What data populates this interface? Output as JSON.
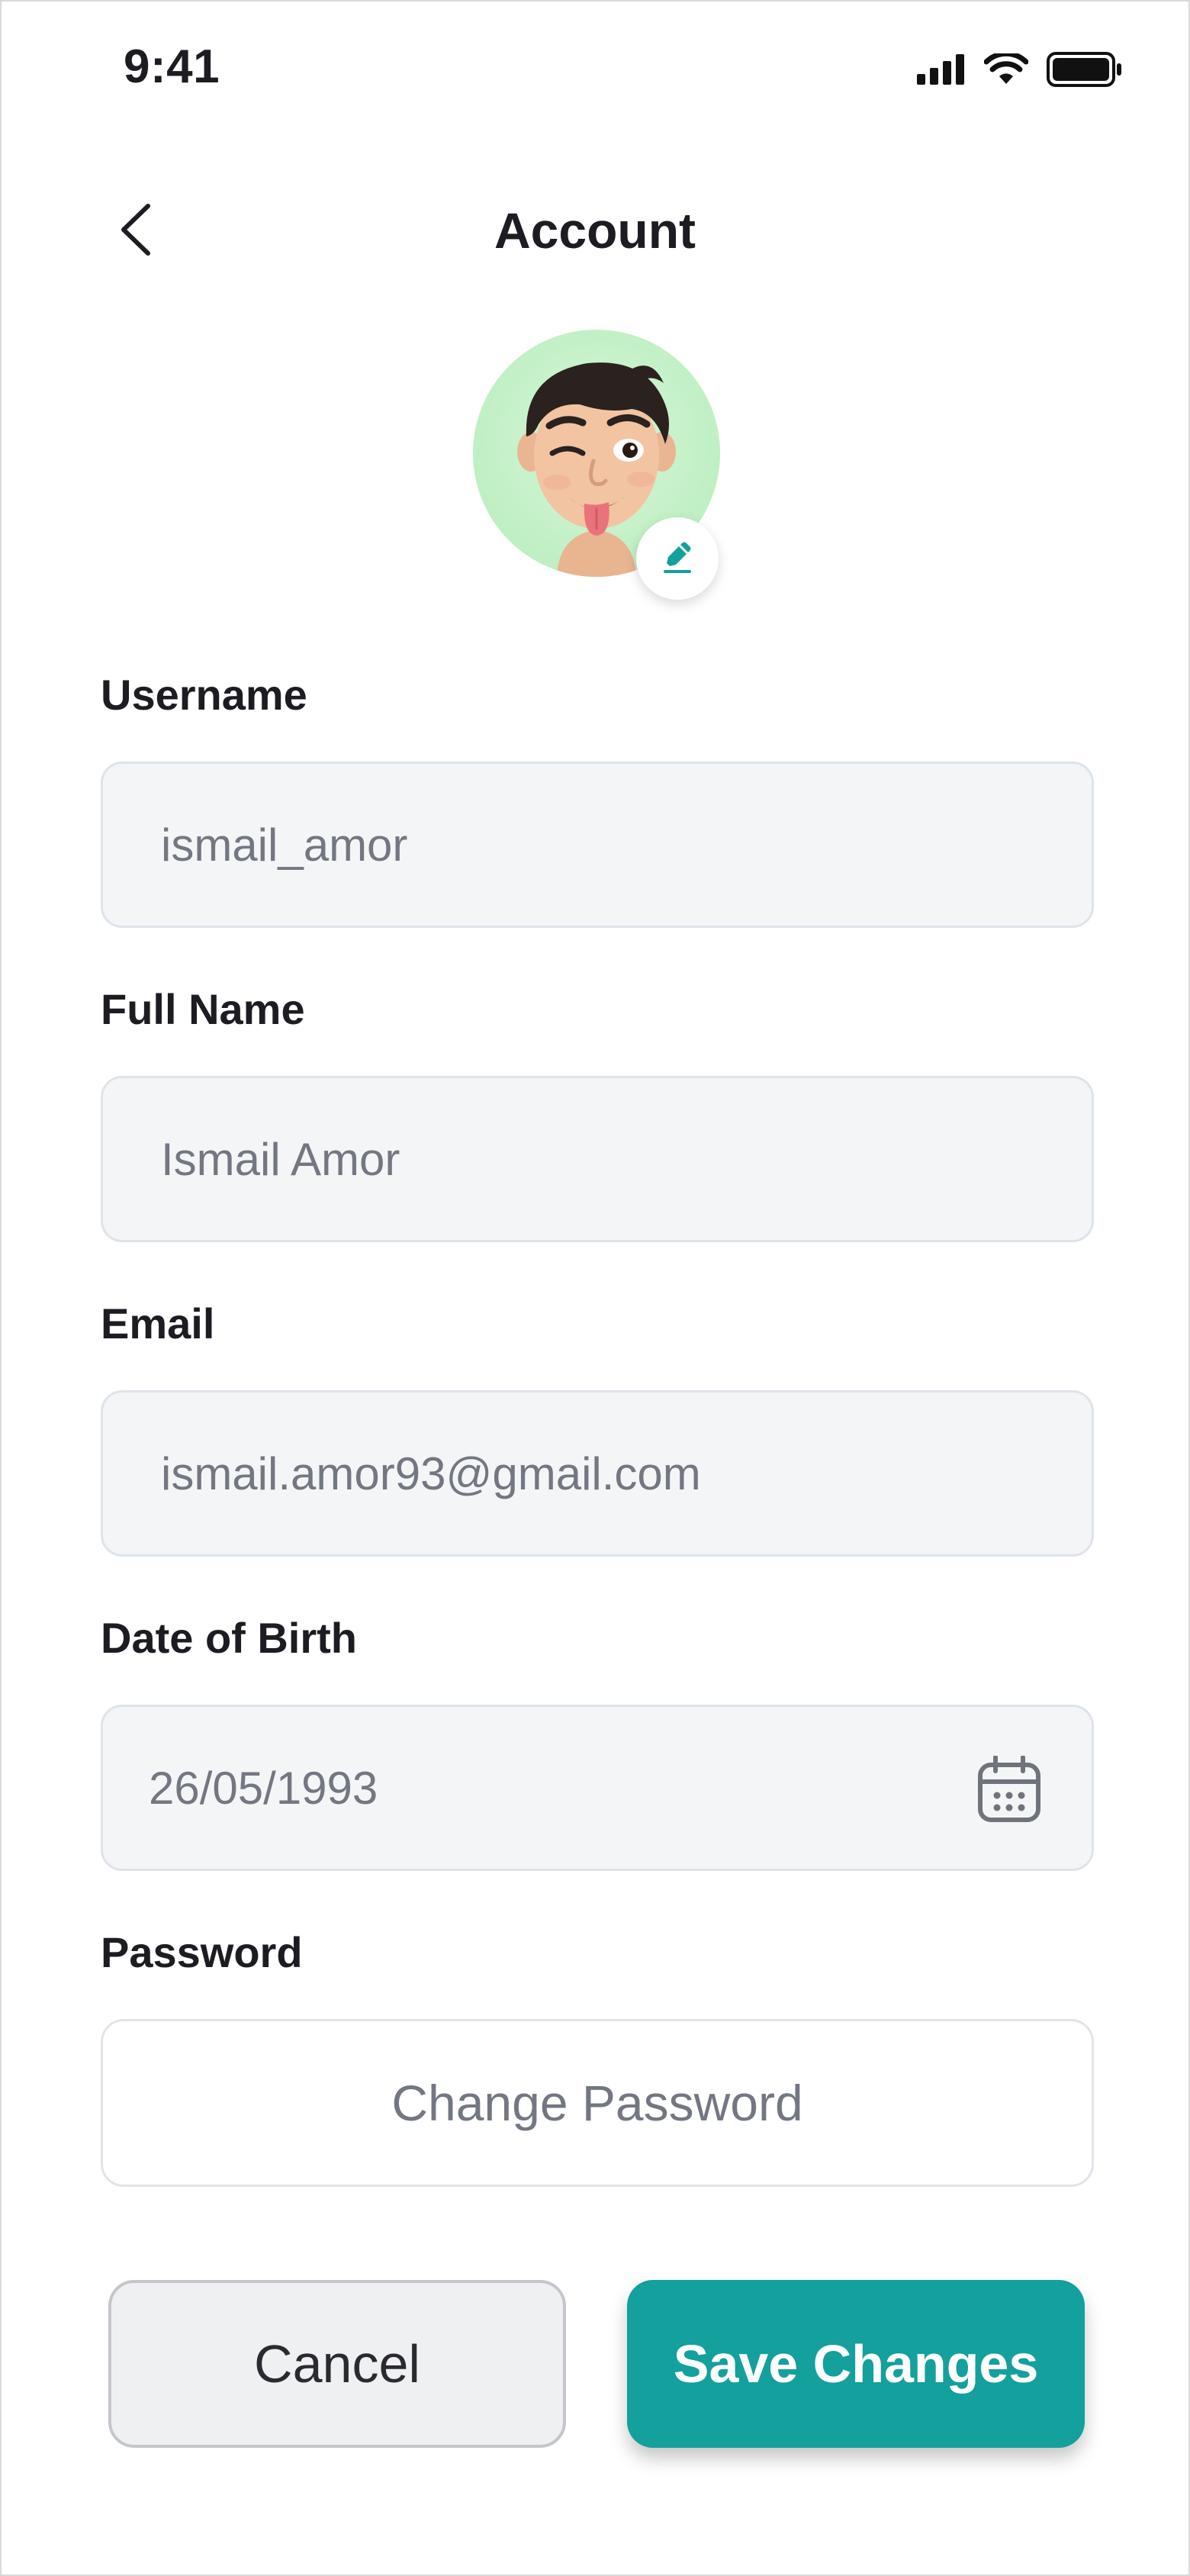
{
  "status_bar": {
    "time": "9:41",
    "icons": [
      "cellular-signal-icon",
      "wifi-icon",
      "battery-icon"
    ]
  },
  "header": {
    "title": "Account",
    "back_icon": "chevron-left-icon"
  },
  "profile": {
    "avatar_description": "memoji-avatar",
    "edit_icon": "edit-pen-icon"
  },
  "form": {
    "username": {
      "label": "Username",
      "value": "ismail_amor"
    },
    "full_name": {
      "label": "Full Name",
      "value": "Ismail Amor"
    },
    "email": {
      "label": "Email",
      "value": "ismail.amor93@gmail.com"
    },
    "date_of_birth": {
      "label": "Date of Birth",
      "value": "26/05/1993",
      "icon": "calendar-icon"
    },
    "password": {
      "label": "Password",
      "action": "Change Password"
    }
  },
  "actions": {
    "cancel": "Cancel",
    "save": "Save Changes"
  },
  "colors": {
    "accent": "#14a09d",
    "avatar_bg": "#b6ecba",
    "field_bg": "#f4f5f7",
    "field_border": "#dfe3ea"
  }
}
